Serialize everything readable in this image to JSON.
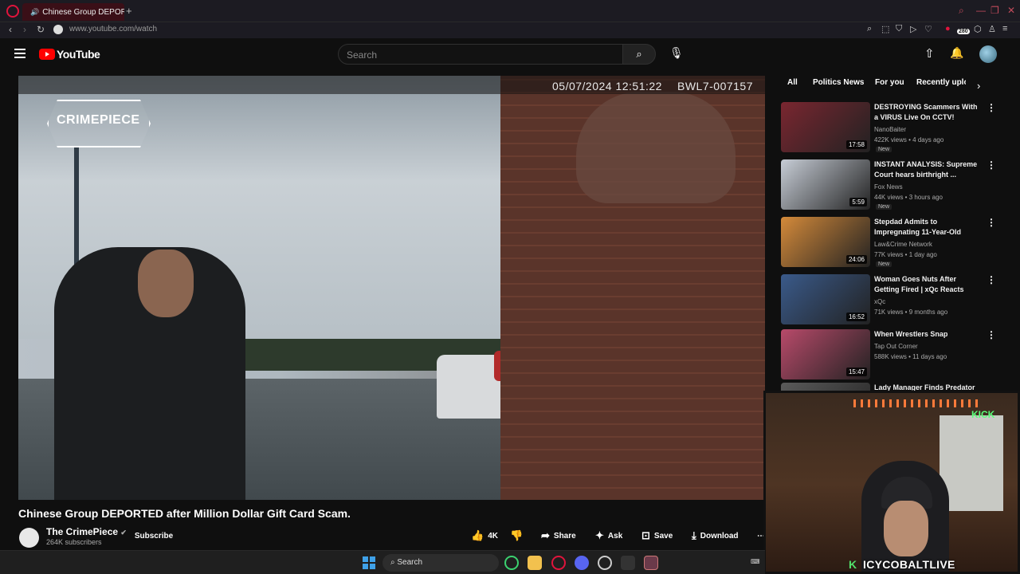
{
  "browser": {
    "tab_title": "Chinese Group DEPORT",
    "url": "www.youtube.com/watch",
    "badge_count": "280"
  },
  "youtube": {
    "logo_text": "YouTube",
    "search_placeholder": "Search"
  },
  "video": {
    "timestamp": "05/07/2024 12:51:22",
    "camera_id": "BWL7-007157",
    "overlay_logo": "CRIMEPIECE",
    "title": "Chinese Group DEPORTED after Million Dollar Gift Card Scam.",
    "channel": "The CrimePiece",
    "subscribers": "264K subscribers",
    "subscribe_label": "Subscribe",
    "actions": {
      "likes": "4K",
      "share": "Share",
      "ask": "Ask",
      "save": "Save",
      "download": "Download"
    }
  },
  "chips": [
    "All",
    "Politics News",
    "For you",
    "Recently uplo"
  ],
  "recommendations": [
    {
      "title": "DESTROYING Scammers With a VIRUS Live On CCTV!",
      "channel": "NanoBaiter",
      "meta": "422K views • 4 days ago",
      "badge": "New",
      "duration": "17:58",
      "color": "#7a2630"
    },
    {
      "title": "INSTANT ANALYSIS: Supreme Court hears birthright ...",
      "channel": "Fox News",
      "meta": "44K views • 3 hours ago",
      "badge": "New",
      "duration": "5:59",
      "color": "#c7cdd6"
    },
    {
      "title": "Stepdad Admits to Impregnating 11-Year-Old",
      "channel": "Law&Crime Network",
      "meta": "77K views • 1 day ago",
      "badge": "New",
      "duration": "24:06",
      "color": "#d48a3a"
    },
    {
      "title": "Woman Goes Nuts After Getting Fired | xQc Reacts",
      "channel": "xQc",
      "meta": "71K views • 9 months ago",
      "badge": "",
      "duration": "16:52",
      "color": "#3a5a8a"
    },
    {
      "title": "When Wrestlers Snap",
      "channel": "Tap Out Corner",
      "meta": "588K views • 11 days ago",
      "badge": "",
      "duration": "15:47",
      "color": "#b84a6a"
    },
    {
      "title": "Lady Manager Finds Predator",
      "channel": "",
      "meta": "",
      "badge": "",
      "duration": "",
      "color": "#5a5a5a"
    }
  ],
  "webcam": {
    "streamer": "ICYCOBALTLIVE",
    "neon_sign": "KICK",
    "logo_letter": "K"
  },
  "taskbar": {
    "search_label": "Search"
  }
}
